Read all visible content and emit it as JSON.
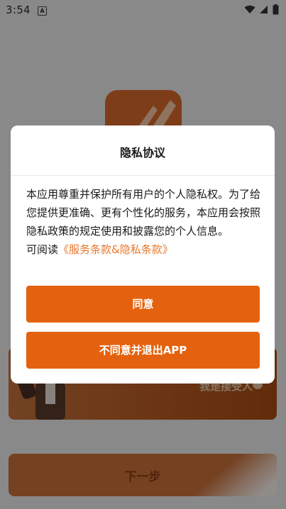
{
  "status_bar": {
    "time": "3:54",
    "notification_icon": "A",
    "icons": [
      "wifi-icon",
      "signal-icon",
      "battery-icon"
    ]
  },
  "background": {
    "banner_text": "我是接受人",
    "next_button_label": "下一步"
  },
  "dialog": {
    "title": "隐私协议",
    "body_text": "本应用尊重并保护所有用户的个人隐私权。为了给您提供更准确、更有个性化的服务，本应用会按照隐私政策的规定使用和披露您的个人信息。",
    "read_prefix": "可阅读",
    "terms_link": "《服务条款&隐私条款》",
    "agree_label": "同意",
    "disagree_label": "不同意并退出APP"
  },
  "colors": {
    "accent": "#e4620f",
    "link": "#e8762a"
  }
}
